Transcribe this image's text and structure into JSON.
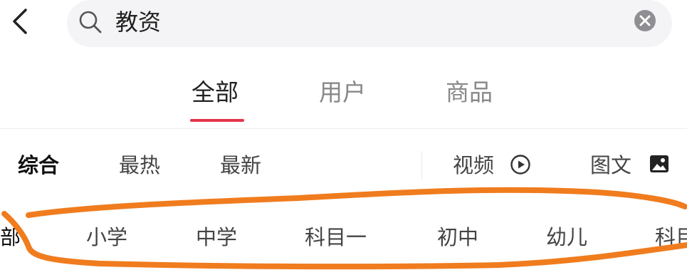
{
  "search": {
    "query": "教资"
  },
  "tabs": [
    {
      "label": "全部",
      "active": true
    },
    {
      "label": "用户",
      "active": false
    },
    {
      "label": "商品",
      "active": false
    }
  ],
  "filters": {
    "sort": [
      {
        "label": "综合",
        "active": true
      },
      {
        "label": "最热",
        "active": false
      },
      {
        "label": "最新",
        "active": false
      }
    ],
    "video_label": "视频",
    "imgtext_label": "图文"
  },
  "chips": [
    "部",
    "小学",
    "中学",
    "科目一",
    "初中",
    "幼儿",
    "科目"
  ],
  "colors": {
    "accent": "#e5344a",
    "annotation": "#f07c1e",
    "search_bg": "#f4f4f6"
  },
  "icons": [
    "back-arrow-icon",
    "search-icon",
    "clear-icon",
    "play-circle-icon",
    "image-icon"
  ]
}
